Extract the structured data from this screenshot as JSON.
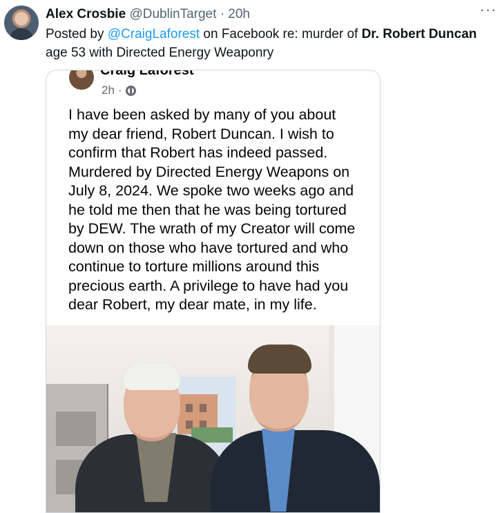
{
  "tweet": {
    "display_name": "Alex Crosbie",
    "handle": "@DublinTarget",
    "separator": "·",
    "time": "20h",
    "text_before": "Posted by ",
    "mention": "@CraigLaforest",
    "text_middle": " on Facebook re: murder of ",
    "bold_name": "Dr. Robert Duncan",
    "text_after": " age 53 with Directed Energy Weaponry"
  },
  "facebook_post": {
    "author": "Craig Laforest",
    "time": "2h",
    "separator": "·",
    "privacy_icon": "globe-icon",
    "body": "I have been asked by many of you about my dear friend, Robert Duncan. I wish to confirm that Robert has indeed passed. Murdered by Directed Energy Weapons on July 8, 2024. We spoke two weeks ago and he told me then that he was being tortured by DEW. The wrath of my Creator will come down on those who have tortured and who continue to torture millions around this precious earth. A privilege to have had you dear Robert, my dear mate, in my life."
  },
  "icons": {
    "more": "more-options-icon"
  },
  "colors": {
    "link": "#1d9bf0",
    "secondary_text": "#536471",
    "border": "#cfd9de"
  }
}
